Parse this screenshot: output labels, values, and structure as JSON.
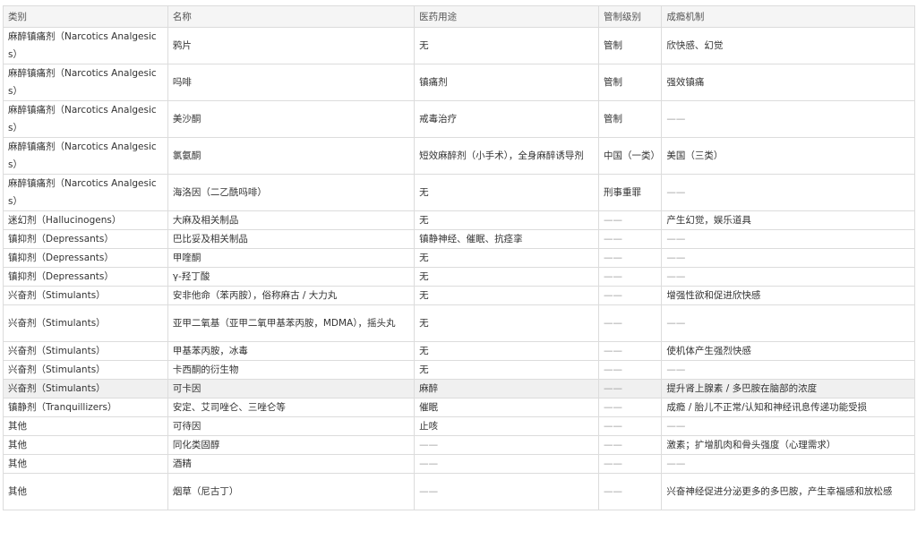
{
  "headers": [
    "类别",
    "名称",
    "医药用途",
    "管制级别",
    "成瘾机制"
  ],
  "rows": [
    {
      "category": "麻醉镇痛剂（Narcotics Analgesics）",
      "name": "鸦片",
      "use": "无",
      "level": "管制",
      "mechanism": "欣快感、幻觉"
    },
    {
      "category": "麻醉镇痛剂（Narcotics Analgesics）",
      "name": "吗啡",
      "use": "镇痛剂",
      "level": "管制",
      "mechanism": "强效镇痛"
    },
    {
      "category": "麻醉镇痛剂（Narcotics Analgesics）",
      "name": "美沙酮",
      "use": "戒毒治疗",
      "level": "管制",
      "mechanism": "——"
    },
    {
      "category": "麻醉镇痛剂（Narcotics Analgesics）",
      "name": "氯氨酮",
      "use": "短效麻醉剂（小手术），全身麻醉诱导剂",
      "level": "中国（一类）",
      "mechanism": "美国（三类）"
    },
    {
      "category": "麻醉镇痛剂（Narcotics Analgesics）",
      "name": "海洛因（二乙酰吗啡）",
      "use": "无",
      "level": "刑事重罪",
      "mechanism": "——"
    },
    {
      "category": "迷幻剂（Hallucinogens）",
      "name": "大麻及相关制品",
      "use": "无",
      "level": "——",
      "mechanism": "产生幻觉，娱乐道具"
    },
    {
      "category": "镇抑剂（Depressants）",
      "name": "巴比妥及相关制品",
      "use": "镇静神经、催眠、抗痉挛",
      "level": "——",
      "mechanism": "——"
    },
    {
      "category": "镇抑剂（Depressants）",
      "name": "甲喹酮",
      "use": "无",
      "level": "——",
      "mechanism": "——"
    },
    {
      "category": "镇抑剂（Depressants）",
      "name": "γ-羟丁酸",
      "use": "无",
      "level": "——",
      "mechanism": "——"
    },
    {
      "category": "兴奋剂（Stimulants）",
      "name": "安非他命（苯丙胺），俗称麻古 / 大力丸",
      "use": "无",
      "level": "——",
      "mechanism": "增强性欲和促进欣快感"
    },
    {
      "category": "兴奋剂（Stimulants）",
      "name": "亚甲二氧基（亚甲二氧甲基苯丙胺，MDMA），摇头丸",
      "use": "无",
      "level": "——",
      "mechanism": "——"
    },
    {
      "category": "兴奋剂（Stimulants）",
      "name": "甲基苯丙胺，冰毒",
      "use": "无",
      "level": "——",
      "mechanism": "使机体产生强烈快感"
    },
    {
      "category": "兴奋剂（Stimulants）",
      "name": "卡西酮的衍生物",
      "use": "无",
      "level": "——",
      "mechanism": "——"
    },
    {
      "category": "兴奋剂（Stimulants）",
      "name": "可卡因",
      "use": "麻醉",
      "level": "——",
      "mechanism": "提升肾上腺素 / 多巴胺在脑部的浓度"
    },
    {
      "category": "镇静剂（Tranquillizers）",
      "name": "安定、艾司唑仑、三唑仑等",
      "use": "催眠",
      "level": "——",
      "mechanism": "成瘾 / 胎儿不正常/认知和神经讯息传递功能受损"
    },
    {
      "category": "其他",
      "name": "可待因",
      "use": "止咳",
      "level": "——",
      "mechanism": "——"
    },
    {
      "category": "其他",
      "name": "同化类固醇",
      "use": "——",
      "level": "——",
      "mechanism": "激素；扩增肌肉和骨头强度（心理需求）"
    },
    {
      "category": "其他",
      "name": "酒精",
      "use": "——",
      "level": "——",
      "mechanism": "——"
    },
    {
      "category": "其他",
      "name": "烟草（尼古丁）",
      "use": "——",
      "level": "——",
      "mechanism": "兴奋神经促进分泌更多的多巴胺，产生幸福感和放松感"
    }
  ]
}
